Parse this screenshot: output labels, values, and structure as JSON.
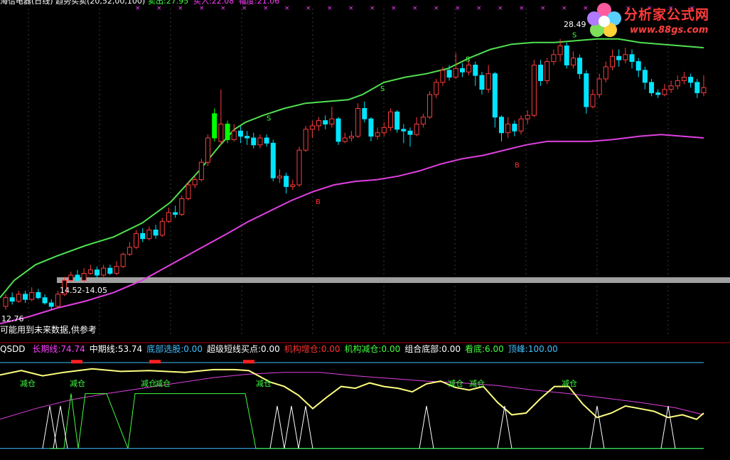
{
  "top_header": {
    "text": "海信电器(日线) 趋势买卖(20,52,00,100)",
    "sell_label": "卖出:27.95",
    "buy_label": "买入:22.08",
    "amplitude_label": "幅度:21.06"
  },
  "main_annotations": {
    "high_price": "28.49",
    "range_label": "14.52-14.05",
    "low_price": "12.76",
    "warning": "可能用到未来数据,供参考",
    "sell_markers": [
      "S",
      "S",
      "S",
      "S"
    ],
    "buy_markers": [
      "B",
      "B"
    ]
  },
  "watermark": {
    "title": "分析家公式网",
    "url": "www.88gs.com"
  },
  "sub_header": {
    "indicator": "QSDD",
    "items": [
      {
        "label": "长期线:74.74",
        "color": "#ff40ff"
      },
      {
        "label": "中期线:53.74",
        "color": "#ffffff"
      },
      {
        "label": "底部选股:0.00",
        "color": "#40c0ff"
      },
      {
        "label": "超级短线买点:0.00",
        "color": "#ffffff"
      },
      {
        "label": "机构增仓:0.00",
        "color": "#ff3030"
      },
      {
        "label": "机构减仓:0.00",
        "color": "#40ff40"
      },
      {
        "label": "组合底部:0.00",
        "color": "#ffffff"
      },
      {
        "label": "看底:6.00",
        "color": "#40ff40"
      },
      {
        "label": "顶峰:100.00",
        "color": "#40c0ff"
      }
    ]
  },
  "sub_annotations": [
    "减仓",
    "减仓",
    "减仓",
    "减仓",
    "减仓",
    "减仓",
    "减仓",
    "减仓"
  ],
  "colors": {
    "up": "#ff3c3c",
    "down": "#00e5ff",
    "upper_band": "#50e050",
    "lower_band": "#e040e0",
    "mid_line": "#ffff80",
    "long_line": "#e040e0",
    "top_line": "#40c0ff",
    "step_line": "#40ff40",
    "spike_line": "#ffffff",
    "separator": "#b00000"
  },
  "chart_data": {
    "type": "candlestick",
    "ylim": [
      11.5,
      30.5
    ],
    "candles": [
      [
        13.1,
        13.6,
        13.8,
        12.9
      ],
      [
        13.6,
        13.4,
        13.9,
        13.2
      ],
      [
        13.4,
        13.8,
        14.0,
        13.3
      ],
      [
        13.8,
        13.5,
        14.0,
        13.3
      ],
      [
        13.5,
        13.9,
        14.2,
        13.4
      ],
      [
        13.9,
        13.6,
        14.1,
        13.5
      ],
      [
        13.6,
        13.3,
        13.8,
        13.2
      ],
      [
        13.3,
        13.1,
        13.5,
        12.9
      ],
      [
        13.1,
        13.8,
        14.0,
        13.0
      ],
      [
        13.8,
        14.6,
        14.8,
        13.7
      ],
      [
        14.6,
        14.9,
        15.1,
        14.5
      ],
      [
        14.9,
        14.6,
        15.2,
        14.5
      ],
      [
        14.6,
        15.0,
        15.3,
        14.5
      ],
      [
        15.0,
        15.2,
        15.5,
        14.9
      ],
      [
        15.2,
        14.9,
        15.4,
        14.7
      ],
      [
        14.9,
        15.3,
        15.5,
        14.8
      ],
      [
        15.3,
        15.0,
        15.5,
        14.9
      ],
      [
        15.0,
        15.4,
        15.7,
        14.9
      ],
      [
        15.4,
        16.1,
        16.2,
        15.3
      ],
      [
        16.1,
        16.5,
        16.8,
        16.0
      ],
      [
        16.5,
        17.3,
        17.5,
        16.4
      ],
      [
        17.3,
        17.0,
        17.6,
        16.8
      ],
      [
        17.0,
        17.5,
        17.7,
        16.9
      ],
      [
        17.5,
        17.2,
        17.8,
        17.0
      ],
      [
        17.2,
        18.0,
        18.2,
        17.1
      ],
      [
        18.0,
        18.5,
        18.8,
        17.9
      ],
      [
        18.5,
        18.4,
        18.9,
        18.2
      ],
      [
        18.4,
        19.3,
        19.5,
        18.3
      ],
      [
        19.3,
        20.1,
        20.3,
        19.2
      ],
      [
        20.1,
        20.4,
        20.6,
        19.9
      ],
      [
        20.4,
        21.4,
        21.6,
        20.3
      ],
      [
        21.4,
        22.8,
        23.0,
        21.2
      ],
      [
        22.8,
        24.2,
        24.5,
        22.6
      ],
      [
        22.6,
        23.6,
        25.6,
        22.4
      ],
      [
        23.6,
        22.7,
        23.8,
        22.5
      ],
      [
        22.7,
        23.2,
        23.6,
        22.6
      ],
      [
        23.2,
        22.9,
        23.5,
        22.5
      ],
      [
        22.9,
        22.8,
        23.2,
        22.4
      ],
      [
        22.8,
        22.4,
        23.1,
        22.2
      ],
      [
        22.4,
        22.8,
        23.0,
        22.2
      ],
      [
        22.8,
        22.5,
        23.0,
        22.3
      ],
      [
        22.5,
        20.5,
        22.7,
        20.3
      ],
      [
        20.5,
        20.6,
        21.0,
        20.2
      ],
      [
        20.6,
        20.0,
        20.8,
        19.6
      ],
      [
        20.0,
        20.1,
        20.4,
        19.8
      ],
      [
        20.1,
        22.1,
        22.3,
        20.0
      ],
      [
        22.1,
        23.3,
        23.5,
        22.0
      ],
      [
        23.3,
        23.5,
        23.8,
        22.8
      ],
      [
        23.5,
        23.8,
        24.0,
        23.2
      ],
      [
        23.8,
        23.6,
        24.1,
        23.3
      ],
      [
        23.6,
        23.9,
        24.6,
        23.4
      ],
      [
        23.9,
        22.6,
        24.0,
        22.4
      ],
      [
        22.6,
        22.8,
        23.1,
        22.5
      ],
      [
        22.8,
        22.9,
        23.2,
        22.6
      ],
      [
        22.9,
        24.5,
        24.8,
        22.8
      ],
      [
        24.5,
        23.9,
        24.9,
        23.7
      ],
      [
        23.9,
        22.9,
        24.0,
        22.6
      ],
      [
        22.9,
        23.1,
        23.4,
        22.7
      ],
      [
        23.1,
        23.4,
        23.7,
        22.9
      ],
      [
        23.4,
        24.3,
        24.5,
        23.2
      ],
      [
        24.3,
        23.3,
        24.4,
        23.1
      ],
      [
        23.3,
        23.2,
        23.6,
        22.5
      ],
      [
        23.2,
        23.0,
        23.4,
        22.3
      ],
      [
        23.0,
        23.6,
        24.0,
        22.9
      ],
      [
        23.6,
        24.0,
        24.2,
        23.4
      ],
      [
        24.0,
        25.3,
        25.5,
        23.9
      ],
      [
        25.3,
        26.0,
        26.2,
        25.1
      ],
      [
        26.0,
        26.7,
        26.9,
        25.8
      ],
      [
        26.7,
        26.3,
        27.0,
        26.1
      ],
      [
        26.3,
        26.8,
        27.7,
        26.2
      ],
      [
        26.8,
        26.6,
        27.1,
        26.3
      ],
      [
        26.6,
        27.0,
        27.3,
        26.4
      ],
      [
        27.0,
        26.4,
        27.2,
        25.8
      ],
      [
        26.4,
        25.6,
        26.6,
        25.3
      ],
      [
        25.6,
        26.5,
        27.0,
        25.4
      ],
      [
        26.5,
        24.0,
        26.6,
        23.4
      ],
      [
        24.0,
        23.1,
        24.1,
        22.6
      ],
      [
        23.1,
        23.6,
        24.0,
        22.8
      ],
      [
        23.6,
        23.2,
        23.8,
        22.9
      ],
      [
        23.2,
        23.9,
        24.1,
        23.0
      ],
      [
        23.9,
        24.1,
        24.4,
        23.6
      ],
      [
        24.1,
        27.0,
        27.3,
        24.0
      ],
      [
        27.0,
        26.1,
        27.3,
        25.8
      ],
      [
        26.1,
        27.2,
        27.4,
        25.9
      ],
      [
        27.2,
        27.6,
        27.9,
        27.0
      ],
      [
        27.6,
        28.1,
        28.5,
        27.2
      ],
      [
        28.1,
        27.0,
        28.3,
        26.8
      ],
      [
        27.0,
        27.4,
        27.8,
        26.8
      ],
      [
        27.4,
        26.5,
        27.6,
        26.2
      ],
      [
        26.5,
        24.6,
        26.7,
        24.2
      ],
      [
        24.6,
        25.3,
        25.6,
        24.5
      ],
      [
        25.3,
        26.2,
        26.5,
        25.1
      ],
      [
        26.2,
        26.9,
        27.2,
        26.0
      ],
      [
        26.9,
        27.5,
        27.9,
        26.7
      ],
      [
        27.5,
        27.3,
        27.9,
        26.9
      ],
      [
        27.3,
        27.6,
        28.0,
        27.1
      ],
      [
        27.6,
        27.2,
        27.9,
        26.8
      ],
      [
        27.2,
        26.7,
        27.4,
        26.3
      ],
      [
        26.7,
        26.0,
        26.9,
        25.6
      ],
      [
        26.0,
        25.4,
        26.2,
        25.2
      ],
      [
        25.4,
        25.3,
        25.6,
        25.1
      ],
      [
        25.3,
        25.6,
        25.9,
        25.2
      ],
      [
        25.6,
        25.8,
        26.1,
        25.4
      ],
      [
        25.8,
        26.1,
        26.4,
        25.6
      ],
      [
        26.1,
        26.3,
        26.6,
        25.9
      ],
      [
        26.3,
        26.0,
        26.5,
        25.7
      ],
      [
        26.0,
        25.4,
        26.2,
        25.1
      ],
      [
        25.4,
        25.7,
        26.4,
        25.2
      ]
    ],
    "upper_band": [
      [
        0,
        13.6
      ],
      [
        20,
        14.6
      ],
      [
        50,
        15.5
      ],
      [
        80,
        16.0
      ],
      [
        120,
        16.6
      ],
      [
        160,
        17.1
      ],
      [
        200,
        17.9
      ],
      [
        240,
        19.1
      ],
      [
        280,
        20.9
      ],
      [
        310,
        22.4
      ],
      [
        330,
        23.3
      ],
      [
        345,
        23.7
      ],
      [
        370,
        24.1
      ],
      [
        400,
        24.5
      ],
      [
        430,
        24.8
      ],
      [
        460,
        24.9
      ],
      [
        490,
        25.0
      ],
      [
        510,
        25.3
      ],
      [
        540,
        26.0
      ],
      [
        570,
        26.3
      ],
      [
        600,
        26.5
      ],
      [
        630,
        26.8
      ],
      [
        660,
        27.4
      ],
      [
        690,
        27.9
      ],
      [
        720,
        28.2
      ],
      [
        750,
        28.3
      ],
      [
        780,
        28.3
      ],
      [
        810,
        28.4
      ],
      [
        840,
        28.5
      ],
      [
        870,
        28.5
      ],
      [
        900,
        28.3
      ],
      [
        930,
        28.2
      ],
      [
        960,
        28.1
      ],
      [
        990,
        28.0
      ]
    ],
    "lower_band": [
      [
        0,
        12.1
      ],
      [
        40,
        12.5
      ],
      [
        80,
        13.0
      ],
      [
        120,
        13.4
      ],
      [
        160,
        13.9
      ],
      [
        200,
        14.6
      ],
      [
        240,
        15.5
      ],
      [
        280,
        16.4
      ],
      [
        320,
        17.3
      ],
      [
        350,
        18.0
      ],
      [
        380,
        18.6
      ],
      [
        410,
        19.2
      ],
      [
        440,
        19.7
      ],
      [
        470,
        20.1
      ],
      [
        500,
        20.3
      ],
      [
        530,
        20.4
      ],
      [
        560,
        20.6
      ],
      [
        590,
        20.9
      ],
      [
        620,
        21.3
      ],
      [
        650,
        21.6
      ],
      [
        680,
        21.8
      ],
      [
        710,
        22.1
      ],
      [
        740,
        22.4
      ],
      [
        770,
        22.6
      ],
      [
        800,
        22.6
      ],
      [
        830,
        22.6
      ],
      [
        860,
        22.7
      ],
      [
        900,
        22.9
      ],
      [
        930,
        23.0
      ],
      [
        960,
        22.9
      ],
      [
        990,
        22.8
      ]
    ],
    "markers": [
      {
        "kind": "S",
        "x": 375,
        "price": 23.8
      },
      {
        "kind": "S",
        "x": 535,
        "price": 25.5
      },
      {
        "kind": "S",
        "x": 655,
        "price": 27.2
      },
      {
        "kind": "S",
        "x": 805,
        "price": 28.6
      },
      {
        "kind": "B",
        "x": 444,
        "price": 19.0
      },
      {
        "kind": "B",
        "x": 724,
        "price": 21.1
      }
    ],
    "sub": {
      "ylim": [
        -5,
        105
      ],
      "top_line": [
        [
          0,
          97
        ],
        [
          30,
          96
        ],
        [
          60,
          98
        ],
        [
          100,
          97
        ],
        [
          140,
          97
        ],
        [
          180,
          98
        ],
        [
          230,
          97
        ],
        [
          300,
          98
        ],
        [
          340,
          97
        ],
        [
          400,
          96
        ],
        [
          500,
          94
        ],
        [
          600,
          93
        ],
        [
          700,
          92
        ],
        [
          800,
          91
        ],
        [
          900,
          90
        ],
        [
          990,
          90
        ]
      ],
      "mid_line": [
        [
          0,
          83
        ],
        [
          30,
          88
        ],
        [
          60,
          82
        ],
        [
          90,
          86
        ],
        [
          130,
          90
        ],
        [
          170,
          87
        ],
        [
          210,
          88
        ],
        [
          260,
          86
        ],
        [
          300,
          89
        ],
        [
          330,
          89
        ],
        [
          350,
          88
        ],
        [
          380,
          75
        ],
        [
          400,
          70
        ],
        [
          420,
          60
        ],
        [
          440,
          45
        ],
        [
          460,
          58
        ],
        [
          480,
          70
        ],
        [
          500,
          68
        ],
        [
          520,
          74
        ],
        [
          540,
          70
        ],
        [
          560,
          68
        ],
        [
          580,
          64
        ],
        [
          600,
          73
        ],
        [
          620,
          76
        ],
        [
          640,
          69
        ],
        [
          660,
          66
        ],
        [
          680,
          70
        ],
        [
          700,
          52
        ],
        [
          720,
          38
        ],
        [
          740,
          40
        ],
        [
          760,
          56
        ],
        [
          780,
          70
        ],
        [
          800,
          70
        ],
        [
          820,
          50
        ],
        [
          840,
          35
        ],
        [
          860,
          40
        ],
        [
          880,
          48
        ],
        [
          900,
          45
        ],
        [
          920,
          42
        ],
        [
          940,
          35
        ],
        [
          960,
          38
        ],
        [
          980,
          33
        ],
        [
          990,
          40
        ]
      ],
      "long_line": [
        [
          0,
          33
        ],
        [
          50,
          45
        ],
        [
          100,
          55
        ],
        [
          150,
          62
        ],
        [
          200,
          68
        ],
        [
          250,
          74
        ],
        [
          300,
          80
        ],
        [
          350,
          84
        ],
        [
          400,
          86
        ],
        [
          450,
          86
        ],
        [
          500,
          82
        ],
        [
          550,
          79
        ],
        [
          600,
          76
        ],
        [
          650,
          74
        ],
        [
          700,
          71
        ],
        [
          750,
          66
        ],
        [
          800,
          62
        ],
        [
          850,
          57
        ],
        [
          900,
          52
        ],
        [
          950,
          46
        ],
        [
          990,
          38
        ]
      ],
      "step_line": [
        [
          70,
          0
        ],
        [
          90,
          0
        ],
        [
          100,
          62
        ],
        [
          110,
          0
        ],
        [
          120,
          62
        ],
        [
          150,
          62
        ],
        [
          180,
          0
        ],
        [
          190,
          62
        ],
        [
          345,
          62
        ],
        [
          360,
          0
        ],
        [
          990,
          0
        ]
      ],
      "spikes": [
        70,
        85,
        390,
        410,
        430,
        600,
        710,
        840,
        940
      ],
      "red_blocks": [
        108,
        218,
        350
      ]
    }
  }
}
